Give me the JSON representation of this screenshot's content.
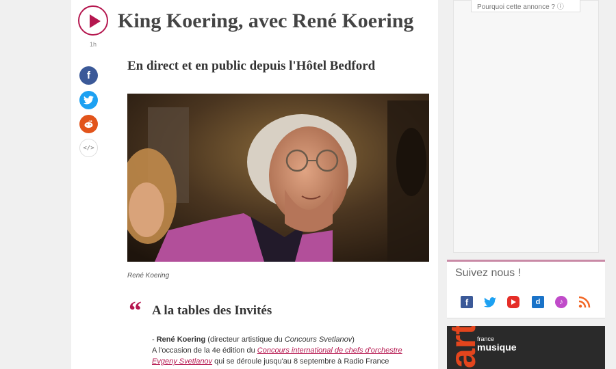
{
  "episode": {
    "duration": "1h",
    "title": "King Koering, avec René Koering",
    "subtitle": "En direct et en public depuis l'Hôtel Bedford",
    "photo_caption": "René Koering"
  },
  "share": {
    "facebook": "f",
    "embed": "</>"
  },
  "guests": {
    "quote_mark": "“",
    "title": "A la tables des Invités",
    "line1_dash": "- ",
    "line1_name": "René Koering",
    "line1_role_pre": " (directeur artistique du ",
    "line1_role_em": "Concours Svetlanov",
    "line1_role_post": ")",
    "line2_pre": "A l'occasion de la 4e édition du ",
    "line2_link": "Concours international de chefs d'orchestre",
    "line3_link": "Evgeny Svetlanov",
    "line3_post": " qui se déroule jusqu'au 8 septembre à Radio France"
  },
  "sidebar": {
    "ad_label": "Pourquoi cette annonce ? ⓘ",
    "follow_title": "Suivez nous !",
    "social_facebook": "f",
    "social_deezer": "d",
    "social_itunes": "♪",
    "promo_arte": "arte",
    "promo_france": "france",
    "promo_musique": "musique"
  },
  "colors": {
    "accent": "#b5174f",
    "facebook": "#3b5998",
    "twitter": "#1da1f2",
    "reddit": "#e2541b",
    "youtube": "#e52d27",
    "rss": "#f26522"
  }
}
